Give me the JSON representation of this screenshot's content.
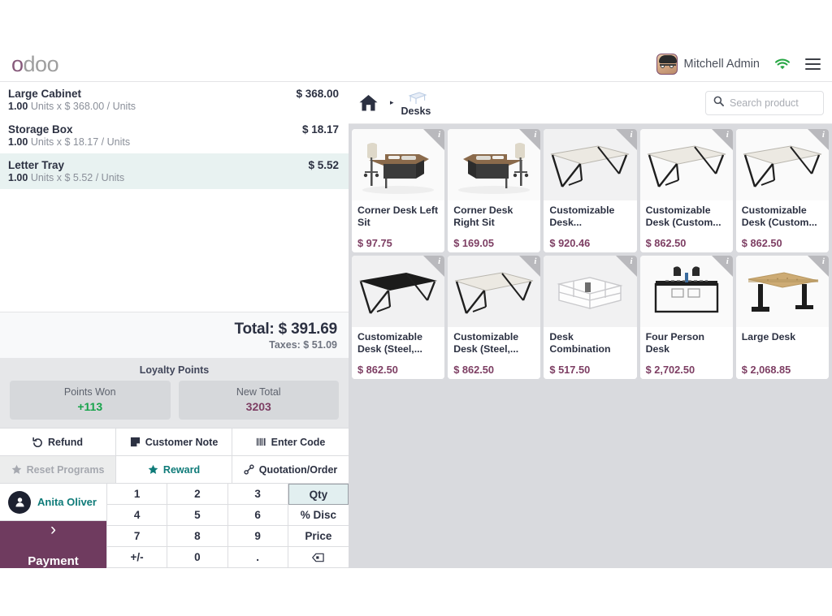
{
  "topbar": {
    "logo_text": "odoo",
    "logo_first_letter": "o",
    "logo_rest": "doo",
    "username": "Mitchell Admin",
    "wifi_icon": "wifi-icon",
    "menu_icon": "hamburger-menu-icon",
    "accent_purple": "#875a7b",
    "wifi_color": "#28a745"
  },
  "order": {
    "lines": [
      {
        "name": "Large Cabinet",
        "qty": "1.00",
        "detail": "Units x $ 368.00 / Units",
        "price": "$ 368.00",
        "selected": false
      },
      {
        "name": "Storage Box",
        "qty": "1.00",
        "detail": "Units x $ 18.17 / Units",
        "price": "$ 18.17",
        "selected": false
      },
      {
        "name": "Letter Tray",
        "qty": "1.00",
        "detail": "Units x $ 5.52 / Units",
        "price": "$ 5.52",
        "selected": true
      }
    ],
    "total_label": "Total: $ 391.69",
    "taxes_label": "Taxes: $ 51.09"
  },
  "loyalty": {
    "title": "Loyalty Points",
    "cards": [
      {
        "label": "Points Won",
        "value": "+113",
        "color": "green"
      },
      {
        "label": "New Total",
        "value": "3203",
        "color": "purple"
      }
    ]
  },
  "controls": [
    {
      "label": "Refund",
      "icon": "refund-undo-icon",
      "state": "normal"
    },
    {
      "label": "Customer Note",
      "icon": "note-icon",
      "state": "normal"
    },
    {
      "label": "Enter Code",
      "icon": "barcode-icon",
      "state": "normal"
    },
    {
      "label": "Reset Programs",
      "icon": "star-icon",
      "state": "disabled"
    },
    {
      "label": "Reward",
      "icon": "star-icon",
      "state": "teal"
    },
    {
      "label": "Quotation/Order",
      "icon": "link-icon",
      "state": "normal"
    }
  ],
  "customer": {
    "name": "Anita Oliver",
    "icon": "user-avatar-icon"
  },
  "payment": {
    "label": "Payment",
    "chevron": "›",
    "color": "#6f3b5f"
  },
  "numpad": [
    {
      "label": "1",
      "active": false
    },
    {
      "label": "2",
      "active": false
    },
    {
      "label": "3",
      "active": false
    },
    {
      "label": "Qty",
      "active": true
    },
    {
      "label": "4",
      "active": false
    },
    {
      "label": "5",
      "active": false
    },
    {
      "label": "6",
      "active": false
    },
    {
      "label": "% Disc",
      "active": false
    },
    {
      "label": "7",
      "active": false
    },
    {
      "label": "8",
      "active": false
    },
    {
      "label": "9",
      "active": false
    },
    {
      "label": "Price",
      "active": false
    },
    {
      "label": "+/-",
      "active": false
    },
    {
      "label": "0",
      "active": false
    },
    {
      "label": ".",
      "active": false
    },
    {
      "label": "⌫",
      "active": false
    }
  ],
  "breadcrumb": {
    "home_icon": "home-icon",
    "separator": "▸",
    "category": "Desks",
    "category_icon": "desk-category-icon"
  },
  "search": {
    "placeholder": "Search product",
    "value": "",
    "icon": "search-icon"
  },
  "products": [
    {
      "name": "Corner Desk Left Sit",
      "price": "$ 97.75",
      "art": "corner-desk-left",
      "bg": "white"
    },
    {
      "name": "Corner Desk Right Sit",
      "price": "$ 169.05",
      "art": "corner-desk-right",
      "bg": "white"
    },
    {
      "name": "Customizable Desk...",
      "price": "$ 920.46",
      "art": "desk-white",
      "bg": "grey"
    },
    {
      "name": "Customizable Desk (Custom...",
      "price": "$ 862.50",
      "art": "desk-white",
      "bg": "white"
    },
    {
      "name": "Customizable Desk (Custom...",
      "price": "$ 862.50",
      "art": "desk-white",
      "bg": "white"
    },
    {
      "name": "Customizable Desk (Steel,...",
      "price": "$ 862.50",
      "art": "desk-black",
      "bg": "grey"
    },
    {
      "name": "Customizable Desk (Steel,...",
      "price": "$ 862.50",
      "art": "desk-white",
      "bg": "grey"
    },
    {
      "name": "Desk Combination",
      "price": "$ 517.50",
      "art": "desk-combination",
      "bg": "grey"
    },
    {
      "name": "Four Person Desk",
      "price": "$ 2,702.50",
      "art": "four-person-desk",
      "bg": "white"
    },
    {
      "name": "Large Desk",
      "price": "$ 2,068.85",
      "art": "large-desk",
      "bg": "white"
    }
  ],
  "info_badge": "i"
}
